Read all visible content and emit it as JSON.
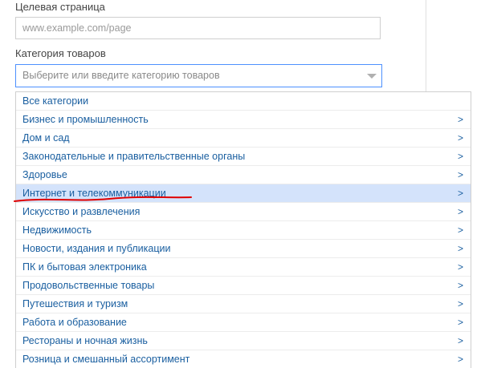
{
  "target_page": {
    "label": "Целевая страница",
    "placeholder": "www.example.com/page"
  },
  "category": {
    "label": "Категория товаров",
    "placeholder": "Выберите или введите категорию товаров"
  },
  "dropdown": {
    "items": [
      {
        "label": "Все категории",
        "arrow": ""
      },
      {
        "label": "Бизнес и промышленность",
        "arrow": ">"
      },
      {
        "label": "Дом и сад",
        "arrow": ">"
      },
      {
        "label": "Законодательные и правительственные органы",
        "arrow": ">"
      },
      {
        "label": "Здоровье",
        "arrow": ">"
      },
      {
        "label": "Интернет и телекоммуникации",
        "arrow": ">"
      },
      {
        "label": "Искусство и развлечения",
        "arrow": ">"
      },
      {
        "label": "Недвижимость",
        "arrow": ">"
      },
      {
        "label": "Новости, издания и публикации",
        "arrow": ">"
      },
      {
        "label": "ПК и бытовая электроника",
        "arrow": ">"
      },
      {
        "label": "Продовольственные товары",
        "arrow": ">"
      },
      {
        "label": "Путешествия и туризм",
        "arrow": ">"
      },
      {
        "label": "Работа и образование",
        "arrow": ">"
      },
      {
        "label": "Рестораны и ночная жизнь",
        "arrow": ">"
      },
      {
        "label": "Розница и смешанный ассортимент",
        "arrow": ">"
      }
    ],
    "highlighted_index": 5
  },
  "colors": {
    "link": "#1a5fa0",
    "highlight": "#d4e3fb",
    "focus_border": "#4d90fe",
    "annotation": "#e00000"
  },
  "icons": {
    "combo_caret": "caret-down-icon",
    "item_arrow": "chevron-right-icon"
  }
}
